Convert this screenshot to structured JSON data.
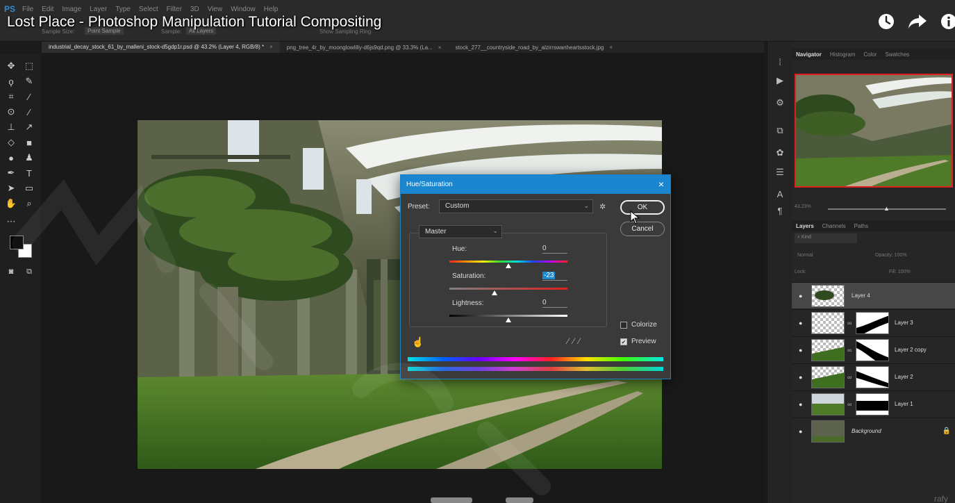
{
  "video_title": "Lost Place - Photoshop Manipulation Tutorial Compositing",
  "channel_watermark": "rafy",
  "menu": {
    "logo": "PS",
    "items": [
      "File",
      "Edit",
      "Image",
      "Layer",
      "Type",
      "Select",
      "Filter",
      "3D",
      "View",
      "Window",
      "Help"
    ]
  },
  "options_bar": {
    "sample_size_label": "Sample Size:",
    "sample_size_value": "Point Sample",
    "sample_label": "Sample:",
    "sample_value": "All Layers",
    "show_ring": "Show Sampling Ring"
  },
  "document_tabs": [
    {
      "label": "industrial_decay_stock_61_by_malleni_stock-d5gdp1r.psd @ 43.2% (Layer 4, RGB/8) *",
      "active": true
    },
    {
      "label": "png_tree_4r_by_moonglowlilly-d6js9qd.png @ 33.3% (La...",
      "active": false
    },
    {
      "label": "stock_277__countryside_road_by_alzirrswanheartsstock.jpg",
      "active": false
    }
  ],
  "tab_close": "×",
  "navigator": {
    "tabs": [
      "Navigator",
      "Histogram",
      "Color",
      "Swatches"
    ],
    "zoom": "43.23%"
  },
  "layers_panel": {
    "tabs": [
      "Layers",
      "Channels",
      "Paths"
    ],
    "kind_placeholder": "Kind",
    "blend_mode": "Normal",
    "opacity_label": "Opacity:",
    "opacity_value": "100%",
    "lock_label": "Lock:",
    "fill_label": "Fill:",
    "fill_value": "100%",
    "layers": [
      {
        "name": "Layer 4",
        "selected": true,
        "has_mask": false
      },
      {
        "name": "Layer 3",
        "selected": false,
        "has_mask": true
      },
      {
        "name": "Layer 2 copy",
        "selected": false,
        "has_mask": true
      },
      {
        "name": "Layer 2",
        "selected": false,
        "has_mask": true
      },
      {
        "name": "Layer 1",
        "selected": false,
        "has_mask": true
      },
      {
        "name": "Background",
        "selected": false,
        "has_mask": false,
        "locked": true
      }
    ]
  },
  "hue_saturation_dialog": {
    "title": "Hue/Saturation",
    "close": "×",
    "preset_label": "Preset:",
    "preset_value": "Custom",
    "channel_value": "Master",
    "ok_label": "OK",
    "cancel_label": "Cancel",
    "hue_label": "Hue:",
    "hue_value": "0",
    "hue_level": 0.5,
    "saturation_label": "Saturation:",
    "saturation_value": "-23",
    "saturation_level": 0.385,
    "lightness_label": "Lightness:",
    "lightness_value": "0",
    "lightness_level": 0.5,
    "colorize_label": "Colorize",
    "colorize_checked": false,
    "preview_label": "Preview",
    "preview_checked": true
  },
  "colors": {
    "accent": "#1b86d0",
    "selection_border": "#e02020",
    "ps_blue": "#2e8bd6"
  },
  "icons": [
    "move-icon",
    "marquee-icon",
    "lasso-icon",
    "quick-select-icon",
    "crop-icon",
    "eyedropper-icon",
    "patch-icon",
    "brush-icon",
    "stamp-icon",
    "history-brush-icon",
    "eraser-icon",
    "gradient-icon",
    "blur-icon",
    "dodge-icon",
    "pen-icon",
    "type-icon",
    "path-select-icon",
    "rectangle-icon",
    "hand-icon",
    "zoom-icon",
    "clock-icon",
    "share-icon",
    "info-icon"
  ]
}
